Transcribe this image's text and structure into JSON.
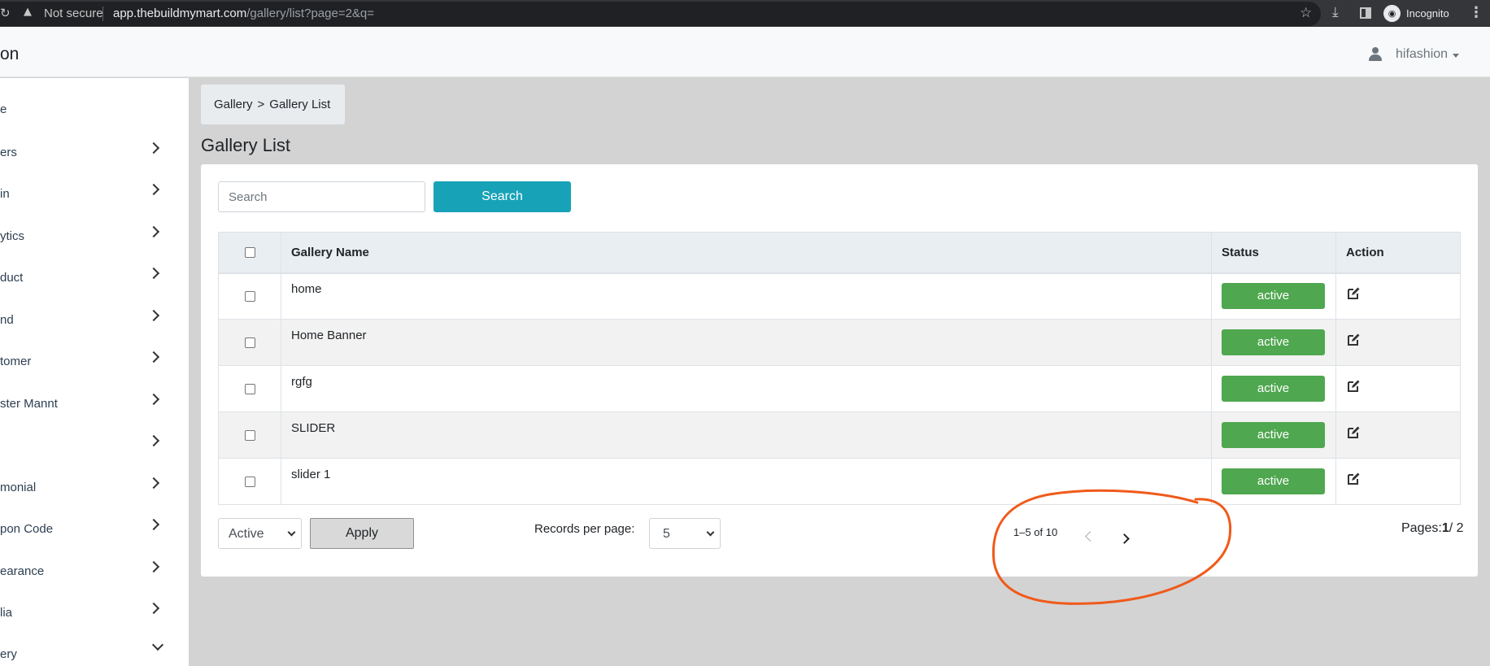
{
  "browser": {
    "security": "Not secure",
    "url_host": "app.thebuildmymart.com",
    "url_path": "/gallery/list?page=2&q=",
    "profile": "Incognito"
  },
  "navbar": {
    "brand": "on",
    "username": "hifashion"
  },
  "sidebar": {
    "items": [
      {
        "label": "e",
        "chevron": "none"
      },
      {
        "label": "ers",
        "chevron": "right"
      },
      {
        "label": "in",
        "chevron": "right"
      },
      {
        "label": "ytics",
        "chevron": "right"
      },
      {
        "label": "duct",
        "chevron": "right"
      },
      {
        "label": "nd",
        "chevron": "right"
      },
      {
        "label": "tomer",
        "chevron": "right"
      },
      {
        "label": "ster Mannt",
        "chevron": "right"
      },
      {
        "label": "",
        "chevron": "right"
      },
      {
        "label": "monial",
        "chevron": "right"
      },
      {
        "label": "pon Code",
        "chevron": "right"
      },
      {
        "label": "earance",
        "chevron": "right"
      },
      {
        "label": "lia",
        "chevron": "right"
      },
      {
        "label": "ery",
        "chevron": "down"
      }
    ]
  },
  "breadcrumb": {
    "parent": "Gallery",
    "separator": ">",
    "current": "Gallery List"
  },
  "page": {
    "title": "Gallery List"
  },
  "search": {
    "placeholder": "Search",
    "button_label": "Search"
  },
  "table": {
    "headers": {
      "name": "Gallery Name",
      "status": "Status",
      "action": "Action"
    },
    "rows": [
      {
        "name": "home",
        "status": "active"
      },
      {
        "name": "Home Banner",
        "status": "active"
      },
      {
        "name": "rgfg",
        "status": "active"
      },
      {
        "name": "SLIDER",
        "status": "active"
      },
      {
        "name": "slider 1",
        "status": "active"
      }
    ]
  },
  "footer": {
    "bulk_status_value": "Active",
    "apply_label": "Apply",
    "records_label": "Records per page:",
    "records_value": "5",
    "range": "1–5 of 10",
    "pages_label": "Pages:",
    "pages_current": "1",
    "pages_total": "/ 2"
  },
  "colors": {
    "primary_button": "#17a2b8",
    "active_badge": "#4fa74f",
    "annotation_stroke": "#f05a1a"
  },
  "icons": {
    "edit": "edit-icon",
    "prev": "chevron-left-icon",
    "next": "chevron-right-icon",
    "user": "user-icon"
  }
}
